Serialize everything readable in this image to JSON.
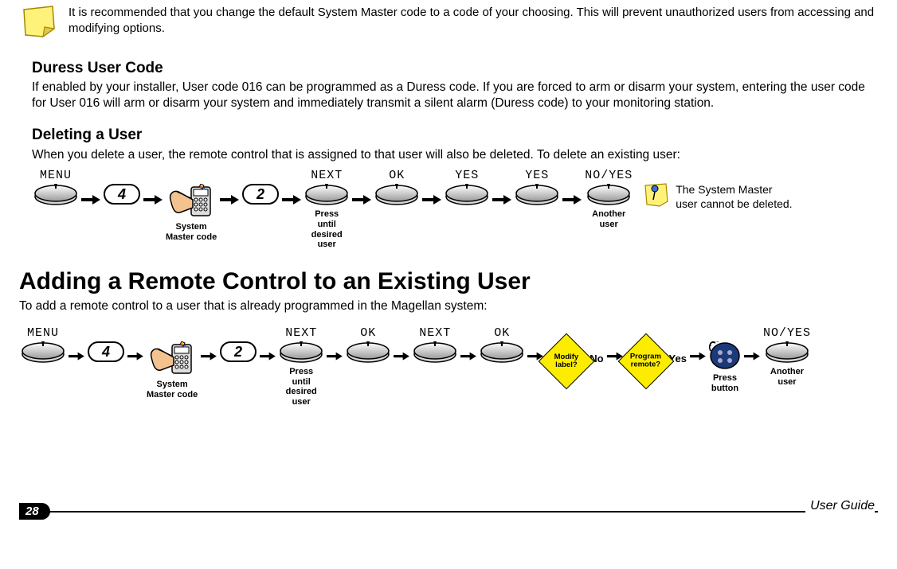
{
  "note_top": "It is recommended that you change the default System Master code to a code of your choosing. This will prevent unauthorized users from accessing and modifying options.",
  "duress": {
    "heading": "Duress User Code",
    "body": "If enabled by your installer, User code 016 can be programmed as a Duress code. If you are forced to arm or disarm your system, entering the user code for User 016 will arm or disarm your system and immediately transmit a silent alarm (Duress code) to your monitoring station."
  },
  "deleting": {
    "heading": "Deleting a User",
    "intro": "When you delete a user, the remote control that is assigned to that user will also be deleted. To delete an existing user:",
    "side_note": "The System Master user cannot be deleted.",
    "steps": {
      "menu": "MENU",
      "key4": "4",
      "master": "System\nMaster code",
      "key2": "2",
      "next": "NEXT",
      "next_sub": "Press\nuntil\ndesired\nuser",
      "ok": "OK",
      "yes1": "YES",
      "yes2": "YES",
      "noyes": "NO/YES",
      "another": "Another\nuser"
    }
  },
  "adding": {
    "heading": "Adding a Remote Control to an Existing User",
    "intro": "To add a remote control to a user that is already programmed in the Magellan system:",
    "steps": {
      "menu": "MENU",
      "key4": "4",
      "master": "System\nMaster code",
      "key2": "2",
      "next1": "NEXT",
      "next_sub": "Press\nuntil\ndesired\nuser",
      "ok1": "OK",
      "next2": "NEXT",
      "ok2": "OK",
      "modify": "Modify\nlabel?",
      "no": "No",
      "program": "Program\nremote?",
      "yes": "Yes",
      "press_button": "Press\nbutton",
      "noyes": "NO/YES",
      "another": "Another\nuser"
    }
  },
  "footer": {
    "page": "28",
    "title": "User Guide"
  }
}
